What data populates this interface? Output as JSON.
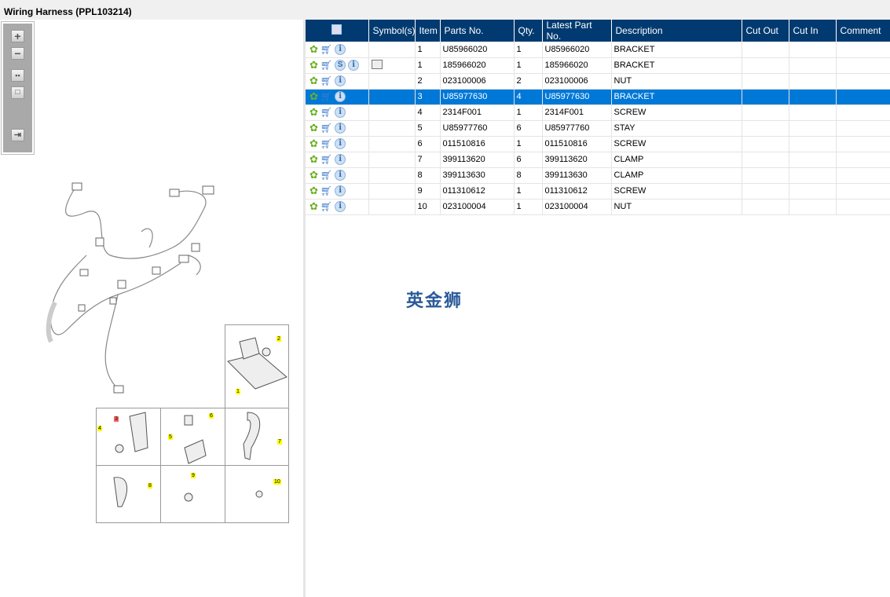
{
  "window": {
    "title": "Wiring Harness (PPL103214)"
  },
  "toolbar": {
    "zoom_in": "+",
    "zoom_out": "−"
  },
  "table": {
    "columns": [
      "",
      "Symbol(s)",
      "Item",
      "Parts No.",
      "Qty.",
      "Latest Part No.",
      "Description",
      "Cut Out",
      "Cut In",
      "Comment"
    ],
    "rows": [
      {
        "item": "1",
        "part": "U85966020",
        "qty": "1",
        "latest": "U85966020",
        "desc": "BRACKET",
        "s": false,
        "symbol": false
      },
      {
        "item": "1",
        "part": "185966020",
        "qty": "1",
        "latest": "185966020",
        "desc": "BRACKET",
        "s": true,
        "symbol": true
      },
      {
        "item": "2",
        "part": "023100006",
        "qty": "2",
        "latest": "023100006",
        "desc": "NUT",
        "s": false,
        "symbol": false
      },
      {
        "item": "3",
        "part": "U85977630",
        "qty": "4",
        "latest": "U85977630",
        "desc": "BRACKET",
        "s": false,
        "symbol": false,
        "selected": true
      },
      {
        "item": "4",
        "part": "2314F001",
        "qty": "1",
        "latest": "2314F001",
        "desc": "SCREW"
      },
      {
        "item": "5",
        "part": "U85977760",
        "qty": "6",
        "latest": "U85977760",
        "desc": "STAY"
      },
      {
        "item": "6",
        "part": "011510816",
        "qty": "1",
        "latest": "011510816",
        "desc": "SCREW"
      },
      {
        "item": "7",
        "part": "399113620",
        "qty": "6",
        "latest": "399113620",
        "desc": "CLAMP"
      },
      {
        "item": "8",
        "part": "399113630",
        "qty": "8",
        "latest": "399113630",
        "desc": "CLAMP"
      },
      {
        "item": "9",
        "part": "011310612",
        "qty": "1",
        "latest": "011310612",
        "desc": "SCREW"
      },
      {
        "item": "10",
        "part": "023100004",
        "qty": "1",
        "latest": "023100004",
        "desc": "NUT"
      }
    ]
  },
  "s_badge": "S",
  "info_badge": "i",
  "watermark": "英金狮",
  "callouts": [
    "1",
    "2",
    "3",
    "4",
    "5",
    "6",
    "7",
    "8",
    "9",
    "10"
  ],
  "colors": {
    "header": "#003a70",
    "selected": "#0078d7",
    "highlight": "#ffff00"
  }
}
